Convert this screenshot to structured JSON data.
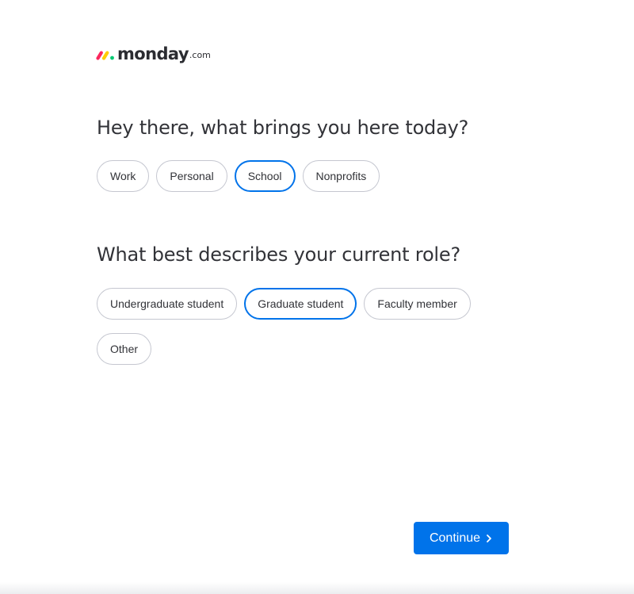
{
  "brand": {
    "name": "monday",
    "suffix": ".com",
    "colors": [
      "#fb275d",
      "#ffcc00",
      "#00ca72"
    ]
  },
  "questions": [
    {
      "title": "Hey there, what brings you here today?",
      "options": [
        "Work",
        "Personal",
        "School",
        "Nonprofits"
      ],
      "selected": "School"
    },
    {
      "title": "What best describes your current role?",
      "options": [
        "Undergraduate student",
        "Graduate student",
        "Faculty member",
        "Other"
      ],
      "selected": "Graduate student"
    }
  ],
  "continue_button": {
    "label": "Continue",
    "icon": "chevron-right-icon",
    "color": "#0073ea"
  },
  "accent_color": "#0073ea"
}
